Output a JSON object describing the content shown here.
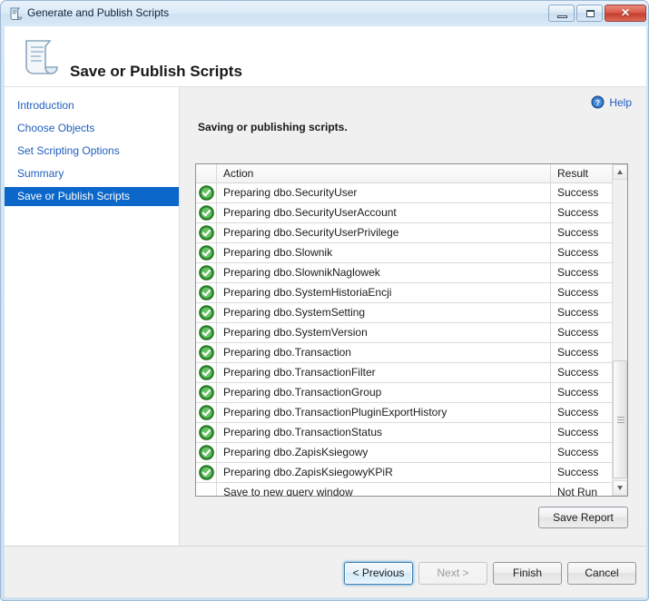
{
  "window": {
    "title": "Generate and Publish Scripts",
    "icon": "script-scroll-icon",
    "controls": {
      "minimize": "minimize-button",
      "maximize": "maximize-button",
      "close": "close-button",
      "close_glyph": "✕"
    }
  },
  "banner": {
    "title": "Save or Publish Scripts",
    "icon": "script-scroll-icon"
  },
  "sidebar": {
    "items": [
      {
        "label": "Introduction",
        "active": false
      },
      {
        "label": "Choose Objects",
        "active": false
      },
      {
        "label": "Set Scripting Options",
        "active": false
      },
      {
        "label": "Summary",
        "active": false
      },
      {
        "label": "Save or Publish Scripts",
        "active": true
      }
    ]
  },
  "content": {
    "help_label": "Help",
    "help_icon": "help-question-icon",
    "section_title": "Saving or publishing scripts.",
    "table": {
      "columns": [
        "",
        "Action",
        "Result"
      ],
      "rows": [
        {
          "status": "success",
          "action": "Preparing dbo.SecurityUser",
          "result": "Success"
        },
        {
          "status": "success",
          "action": "Preparing dbo.SecurityUserAccount",
          "result": "Success"
        },
        {
          "status": "success",
          "action": "Preparing dbo.SecurityUserPrivilege",
          "result": "Success"
        },
        {
          "status": "success",
          "action": "Preparing dbo.Slownik",
          "result": "Success"
        },
        {
          "status": "success",
          "action": "Preparing dbo.SlownikNaglowek",
          "result": "Success"
        },
        {
          "status": "success",
          "action": "Preparing dbo.SystemHistoriaEncji",
          "result": "Success"
        },
        {
          "status": "success",
          "action": "Preparing dbo.SystemSetting",
          "result": "Success"
        },
        {
          "status": "success",
          "action": "Preparing dbo.SystemVersion",
          "result": "Success"
        },
        {
          "status": "success",
          "action": "Preparing dbo.Transaction",
          "result": "Success"
        },
        {
          "status": "success",
          "action": "Preparing dbo.TransactionFilter",
          "result": "Success"
        },
        {
          "status": "success",
          "action": "Preparing dbo.TransactionGroup",
          "result": "Success"
        },
        {
          "status": "success",
          "action": "Preparing dbo.TransactionPluginExportHistory",
          "result": "Success"
        },
        {
          "status": "success",
          "action": "Preparing dbo.TransactionStatus",
          "result": "Success"
        },
        {
          "status": "success",
          "action": "Preparing dbo.ZapisKsiegowy",
          "result": "Success"
        },
        {
          "status": "success",
          "action": "Preparing dbo.ZapisKsiegowyKPiR",
          "result": "Success"
        },
        {
          "status": "none",
          "action": "Save to new query window",
          "result": "Not Run"
        }
      ]
    },
    "save_report_label": "Save Report"
  },
  "footer": {
    "previous_label": "< Previous",
    "next_label": "Next >",
    "finish_label": "Finish",
    "cancel_label": "Cancel"
  },
  "colors": {
    "accent": "#0b67c9",
    "link": "#1f5fbf",
    "success": "#3f9f3f",
    "window_border": "#9ab8d4",
    "close_button": "#c43c2c"
  }
}
